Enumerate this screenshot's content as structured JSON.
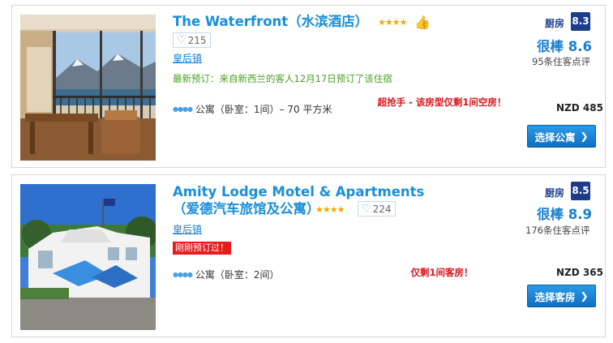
{
  "listings": [
    {
      "name": "The Waterfront（水滨酒店）",
      "stars": "★★★★",
      "likes": "215",
      "area": "皇后镇",
      "recent_booking": "最新预订：来自新西兰的客人12月17日预订了该住宿",
      "room_info": "公寓（卧室：1间）– 70 平方米",
      "urgency": "超抢手 - 该房型仅剩1间空房！",
      "rating_label": "厨房",
      "rating_score": "8.3",
      "verdict": "很棒 8.6",
      "reviews": "95条住客点评",
      "price": "NZD 485",
      "cta": "选择公寓"
    },
    {
      "name": "Amity Lodge Motel & Apartments（爱德汽车旅馆及公寓）",
      "stars": "★★★★",
      "likes": "224",
      "area": "皇后镇",
      "just_booked": "刚刚预订过！",
      "room_info": "公寓（卧室：2间）",
      "urgency": "仅剩1间客房！",
      "rating_label": "厨房",
      "rating_score": "8.5",
      "verdict": "很棒 8.9",
      "reviews": "176条住客点评",
      "price": "NZD 365",
      "cta": "选择客房"
    }
  ],
  "colors": {
    "link_blue": "#1a8fd8",
    "badge_navy": "#1c3d8c",
    "urgent_red": "#d8151c",
    "recent_green": "#4a9e24",
    "star_gold": "#f5a800"
  }
}
